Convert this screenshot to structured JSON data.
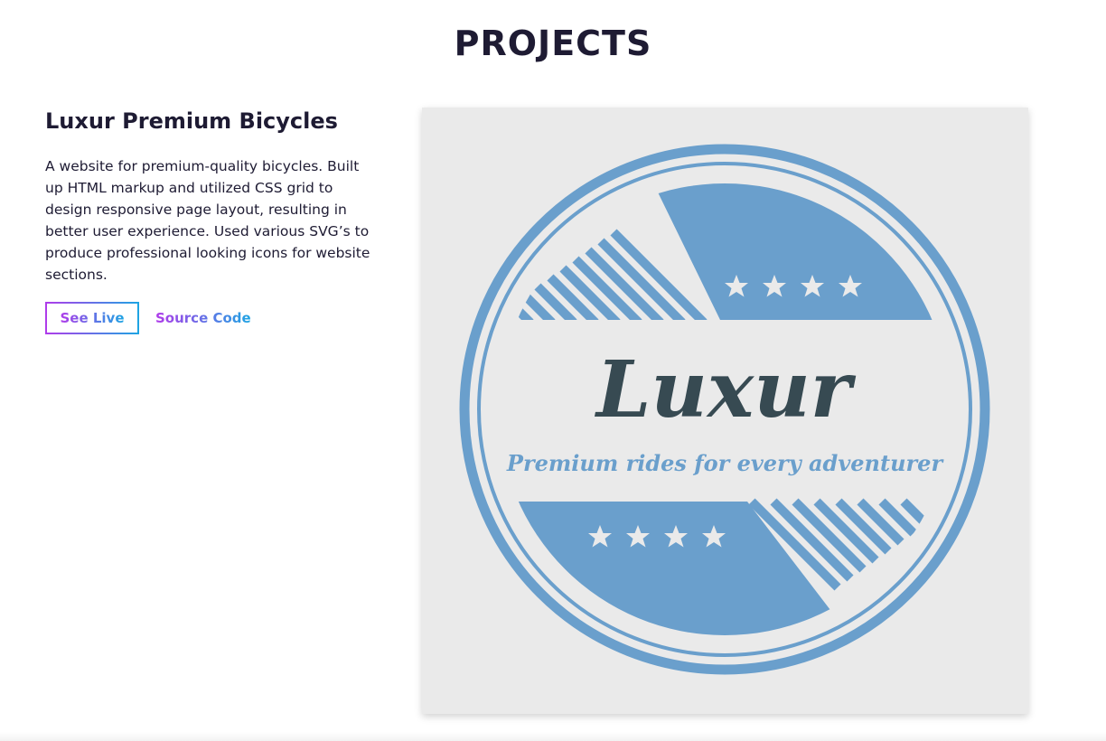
{
  "section": {
    "title": "PROJECTS"
  },
  "project": {
    "title": "Luxur Premium Bicycles",
    "description": "A website for premium-quality bicycles. Built up HTML markup and utilized CSS grid to design responsive page layout, resulting in better user experience. Used various SVG’s to produce professional looking icons for website sections.",
    "buttons": {
      "live_label": "See Live",
      "source_label": "Source Code"
    },
    "logo": {
      "brand": "Luxur",
      "tagline": "Premium rides for every adventurer"
    }
  },
  "colors": {
    "heading": "#1e1b33",
    "gradient_start": "#b03bea",
    "gradient_end": "#1da5e3",
    "logo_blue": "#6a9fcc",
    "logo_text": "#374a52",
    "image_bg": "#eaeaea"
  }
}
